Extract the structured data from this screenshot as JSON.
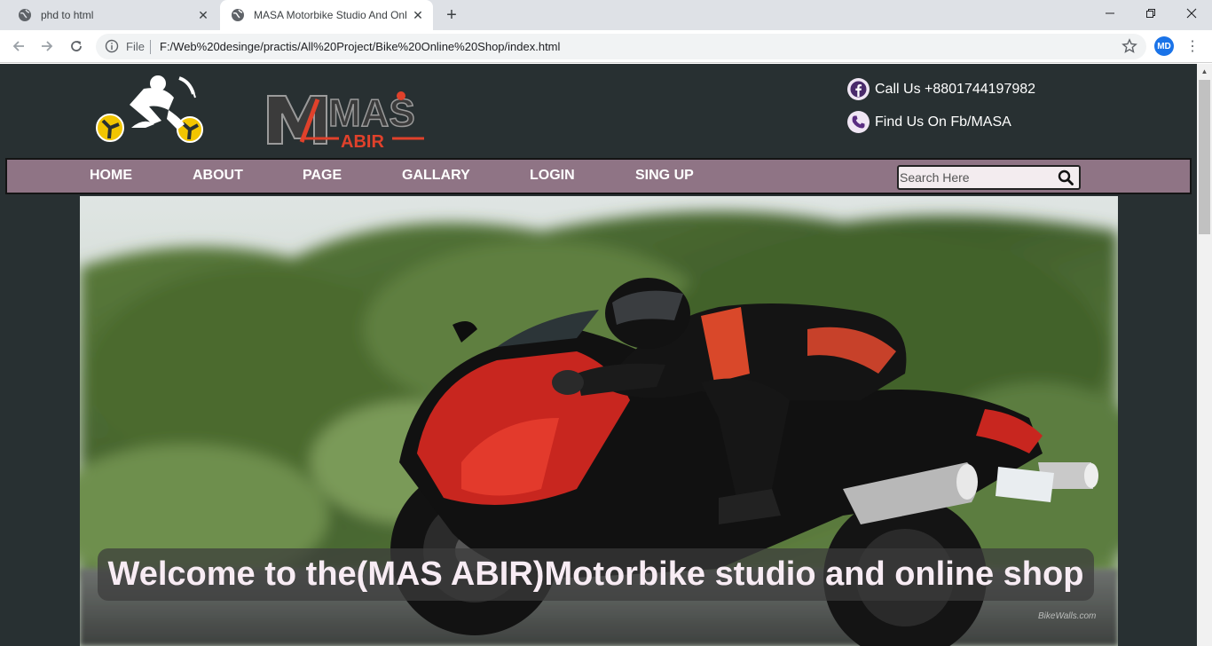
{
  "browser": {
    "tabs": [
      {
        "title": "phd to html",
        "active": false
      },
      {
        "title": "MASA Motorbike Studio And Onl",
        "active": true
      }
    ],
    "address": {
      "scheme_label": "File",
      "url": "F:/Web%20desinge/practis/All%20Project/Bike%20Online%20Shop/index.html"
    },
    "profile_initials": "MD"
  },
  "header": {
    "logo_text": {
      "mas": "MAS",
      "abir": "ABIR"
    },
    "contacts": [
      {
        "icon": "facebook-icon",
        "text": "Call Us +8801744197982"
      },
      {
        "icon": "phone-icon",
        "text": "Find Us On Fb/MASA"
      }
    ]
  },
  "nav": {
    "items": [
      "HOME",
      "ABOUT",
      "PAGE",
      "GALLARY",
      "LOGIN",
      "SING UP"
    ],
    "search_placeholder": "Search Here"
  },
  "hero": {
    "caption": "Welcome to the(MAS ABIR)Motorbike studio and online shop",
    "watermark": "BikeWalls.com"
  },
  "colors": {
    "page_bg": "#283032",
    "nav_bg": "#8f7485",
    "caption_text": "#f8ecf4"
  }
}
